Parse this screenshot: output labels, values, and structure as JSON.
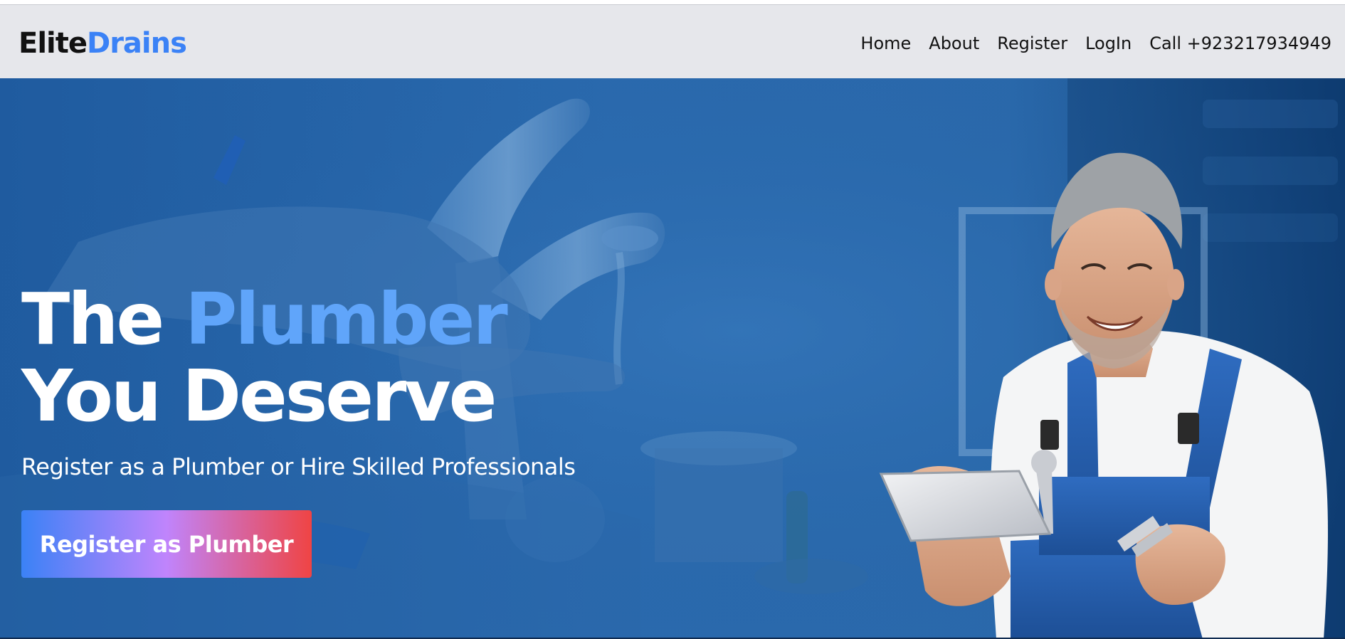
{
  "brand": {
    "part1": "Elite",
    "part2": "Drains"
  },
  "nav": {
    "home": "Home",
    "about": "About",
    "register": "Register",
    "login": "LogIn",
    "call": "Call +923217934949"
  },
  "hero": {
    "title_line1_prefix": "The ",
    "title_line1_accent": "Plumber",
    "title_line2": "You Deserve",
    "subtitle": "Register as a Plumber or Hire Skilled Professionals",
    "cta_label": "Register as Plumber",
    "background_subject": "faucet and hand with water",
    "person_subject": "smiling plumber holding tablet"
  },
  "colors": {
    "brand_accent": "#3b82f6",
    "title_accent": "#60a5fa",
    "hero_blue": "#2a6aae",
    "nav_bg": "#e6e7eb",
    "cta_gradient": [
      "#3b82f6",
      "#c084fc",
      "#ef4444"
    ]
  }
}
